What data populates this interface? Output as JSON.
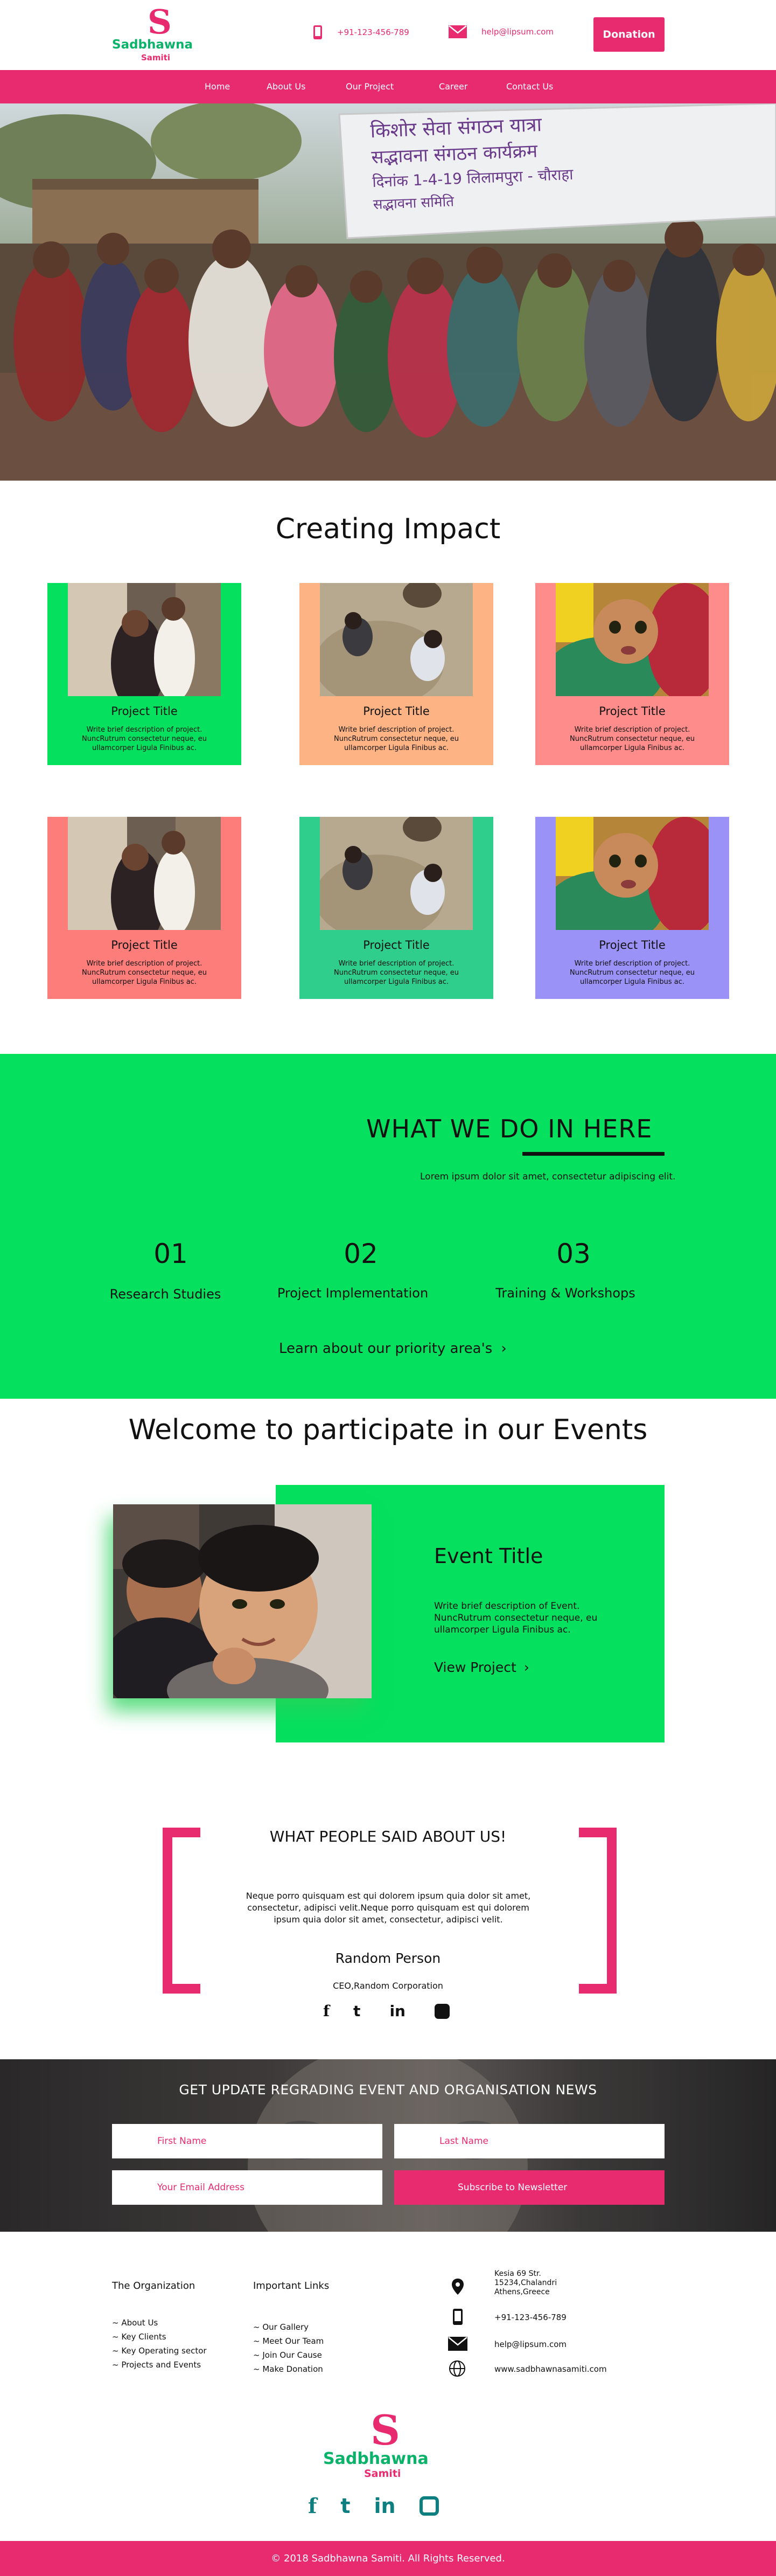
{
  "header": {
    "logo_letter": "S",
    "logo_name": "Sadbhawna",
    "logo_sub": "Samiti",
    "phone": "+91-123-456-789",
    "email": "help@lipsum.com",
    "donation_label": "Donation"
  },
  "nav": {
    "items": [
      "Home",
      "About Us",
      "Our Project",
      "Career",
      "Contact Us"
    ]
  },
  "hero": {
    "banner_lines": [
      "किशोर सेवा संगठन यात्रा",
      "सद्भावना संगठन कार्यक्रम",
      "दिनांक 1-4-19 लिलामपुरा - चौराहा",
      "सद्भावना समिति"
    ]
  },
  "impact": {
    "title": "Creating Impact",
    "cards": [
      {
        "title": "Project Title",
        "desc": "Write brief description of project. NuncRutrum consectetur neque, eu ullamcorper Ligula Finibus ac.",
        "bg": "#05e05e",
        "photo": "girls"
      },
      {
        "title": "Project Title",
        "desc": "Write brief description of project. NuncRutrum consectetur neque, eu ullamcorper Ligula Finibus ac.",
        "bg": "#fdb383",
        "photo": "kids"
      },
      {
        "title": "Project Title",
        "desc": "Write brief description of project. NuncRutrum consectetur neque, eu ullamcorper Ligula Finibus ac.",
        "bg": "#fd8c8a",
        "photo": "baby"
      },
      {
        "title": "Project Title",
        "desc": "Write brief description of project. NuncRutrum consectetur neque, eu ullamcorper Ligula Finibus ac.",
        "bg": "#fd7d7b",
        "photo": "girls"
      },
      {
        "title": "Project Title",
        "desc": "Write brief description of project. NuncRutrum consectetur neque, eu ullamcorper Ligula Finibus ac.",
        "bg": "#2fce8c",
        "photo": "kids"
      },
      {
        "title": "Project Title",
        "desc": "Write brief description of project. NuncRutrum consectetur neque, eu ullamcorper Ligula Finibus ac.",
        "bg": "#9b92f7",
        "photo": "baby"
      }
    ]
  },
  "what_we_do": {
    "title": "WHAT WE DO IN HERE",
    "subtitle": "Lorem ipsum dolor sit amet, consectetur adipiscing elit.",
    "items": [
      {
        "num": "01",
        "label": "Research Studies"
      },
      {
        "num": "02",
        "label": "Project Implementation"
      },
      {
        "num": "03",
        "label": "Training & Workshops"
      }
    ],
    "link": "Learn about our priority area's",
    "link_arrow": "›"
  },
  "events": {
    "title": "Welcome to participate in our Events",
    "event_title": "Event Title",
    "desc": "Write brief description of Event. NuncRutrum consectetur neque, eu ullamcorper Ligula Finibus ac.",
    "link": "View Project",
    "link_arrow": "›"
  },
  "testimonial": {
    "title": "WHAT PEOPLE SAID ABOUT US!",
    "quote": "Neque porro quisquam est qui dolorem ipsum quia dolor sit amet, consectetur, adipisci velit.Neque porro quisquam est qui dolorem ipsum quia dolor sit amet, consectetur, adipisci velit.",
    "name": "Random Person",
    "role": "CEO,Random Corporation",
    "social": [
      "f",
      "t",
      "in",
      ""
    ]
  },
  "newsletter": {
    "title": "GET UPDATE REGRADING EVENT AND ORGANISATION NEWS",
    "first_name": "First Name",
    "last_name": "Last Name",
    "email": "Your Email Address",
    "subscribe": "Subscribe to Newsletter"
  },
  "footer": {
    "org_heading": "The Organization",
    "org_links": [
      "~ About Us",
      "~ Key Clients",
      "~ Key Operating sector",
      "~ Projects and Events"
    ],
    "links_heading": "Important Links",
    "imp_links": [
      "~ Our Gallery",
      "~ Meet Our Team",
      "~ Join Our Cause",
      "~ Make Donation"
    ],
    "address": "Kesia 69 Str. 15234,Chalandri Athens,Greece",
    "phone": "+91-123-456-789",
    "email": "help@lipsum.com",
    "website": "www.sadbhawnasamiti.com",
    "copyright": "© 2018 Sadbhawna Samiti. All Rights Reserved.",
    "social": [
      "f",
      "t",
      "in",
      ""
    ]
  }
}
